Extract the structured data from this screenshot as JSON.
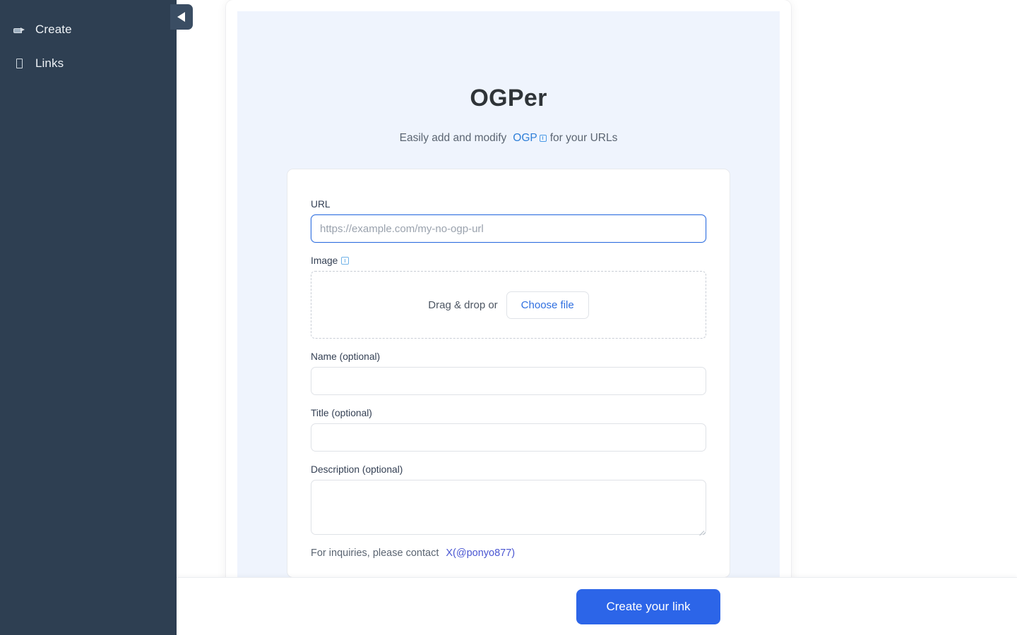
{
  "sidebar": {
    "items": [
      {
        "label": "Create",
        "icon": "pen-icon"
      },
      {
        "label": "Links",
        "icon": "link-icon"
      }
    ],
    "collapse_toggle": "collapse-sidebar"
  },
  "hero": {
    "title": "OGPer",
    "subtitle_prefix": "Easily add and modify",
    "subtitle_link": "OGP",
    "subtitle_suffix": "for your URLs"
  },
  "form": {
    "url": {
      "label": "URL",
      "placeholder": "https://example.com/my-no-ogp-url",
      "value": ""
    },
    "image": {
      "label": "Image",
      "dropzone_text": "Drag & drop or",
      "choose_file_label": "Choose file"
    },
    "name": {
      "label": "Name (optional)",
      "placeholder": "",
      "value": ""
    },
    "title": {
      "label": "Title (optional)",
      "placeholder": "",
      "value": ""
    },
    "description": {
      "label": "Description (optional)",
      "placeholder": "",
      "value": ""
    },
    "contact_text": "For inquiries, please contact",
    "contact_link": "X(@ponyo877)"
  },
  "action_bar": {
    "submit_label": "Create your link"
  },
  "colors": {
    "sidebar_bg": "#2e3f52",
    "hero_bg": "#eff4fd",
    "primary": "#2c65e8",
    "link_blue": "#2f7fd8",
    "contact_link": "#4a56d2"
  }
}
